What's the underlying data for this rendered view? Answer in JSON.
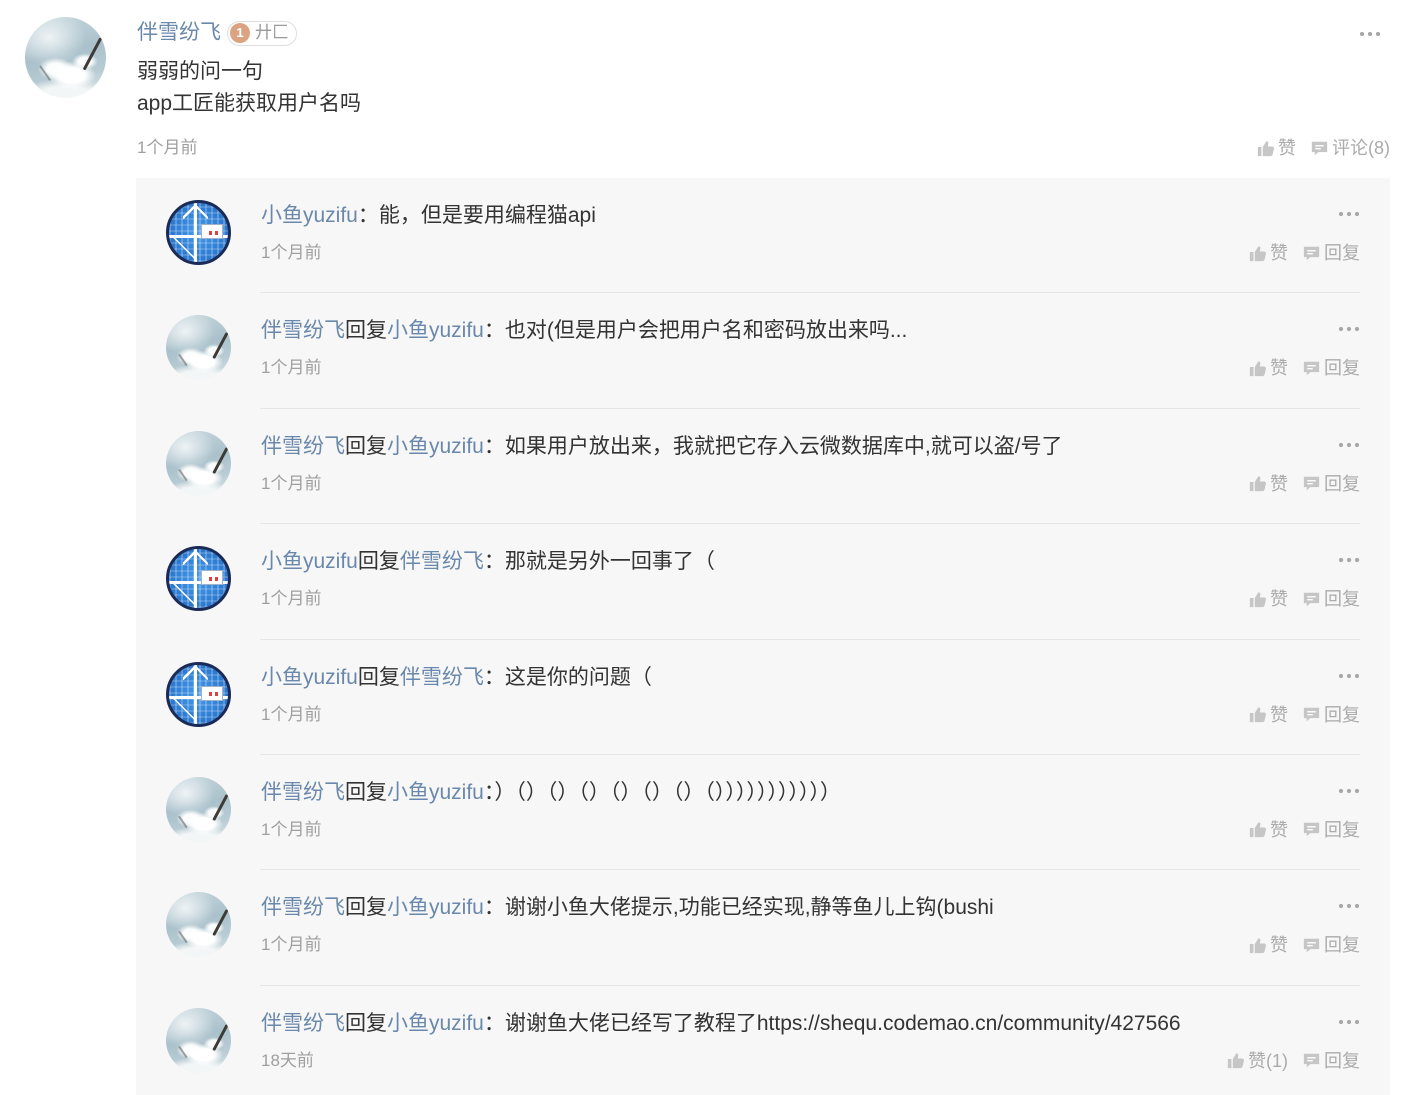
{
  "theme": {
    "link": "#6a88ab",
    "text": "#333333",
    "muted": "#9f9f9f",
    "panel": "#f7f7f7",
    "badge": "#dca383"
  },
  "post": {
    "avatar_icon": "snow-avatar",
    "author": "伴雪纷飞",
    "badge": {
      "level": "1",
      "text": "廾匚"
    },
    "lines": [
      "弱弱的问一句",
      "app工匠能获取用户名吗"
    ],
    "time": "1个月前",
    "like": "赞",
    "comment": "评论(8)"
  },
  "replies": [
    {
      "avatar_icon": "fish-avatar",
      "author": "小鱼yuzifu",
      "sep": "：",
      "content": "能，但是要用编程猫api",
      "time": "1个月前",
      "like": "赞",
      "reply": "回复"
    },
    {
      "avatar_icon": "snow-avatar",
      "author": "伴雪纷飞",
      "reply_word": "回复",
      "target": "小鱼yuzifu",
      "sep": "：",
      "content": "也对(但是用户会把用户名和密码放出来吗...",
      "time": "1个月前",
      "like": "赞",
      "reply": "回复"
    },
    {
      "avatar_icon": "snow-avatar",
      "author": "伴雪纷飞",
      "reply_word": "回复",
      "target": "小鱼yuzifu",
      "sep": "：",
      "content": "如果用户放出来，我就把它存入云微数据库中,就可以盗/号了",
      "time": "1个月前",
      "like": "赞",
      "reply": "回复"
    },
    {
      "avatar_icon": "fish-avatar",
      "author": "小鱼yuzifu",
      "reply_word": "回复",
      "target": "伴雪纷飞",
      "sep": "：",
      "content": "那就是另外一回事了（",
      "time": "1个月前",
      "like": "赞",
      "reply": "回复"
    },
    {
      "avatar_icon": "fish-avatar",
      "author": "小鱼yuzifu",
      "reply_word": "回复",
      "target": "伴雪纷飞",
      "sep": "：",
      "content": "这是你的问题（",
      "time": "1个月前",
      "like": "赞",
      "reply": "回复"
    },
    {
      "avatar_icon": "snow-avatar",
      "author": "伴雪纷飞",
      "reply_word": "回复",
      "target": "小鱼yuzifu",
      "sep": "：",
      "content": "）（）（）（）（）（）（）（）））））））））））",
      "time": "1个月前",
      "like": "赞",
      "reply": "回复"
    },
    {
      "avatar_icon": "snow-avatar",
      "author": "伴雪纷飞",
      "reply_word": "回复",
      "target": "小鱼yuzifu",
      "sep": "：",
      "content": "谢谢小鱼大佬提示,功能已经实现,静等鱼儿上钩(bushi",
      "time": "1个月前",
      "like": "赞",
      "reply": "回复"
    },
    {
      "avatar_icon": "snow-avatar",
      "author": "伴雪纷飞",
      "reply_word": "回复",
      "target": "小鱼yuzifu",
      "sep": "：",
      "content": "谢谢鱼大佬已经写了教程了https://shequ.codemao.cn/community/427566",
      "time": "18天前",
      "like": "赞(1)",
      "reply": "回复"
    }
  ]
}
